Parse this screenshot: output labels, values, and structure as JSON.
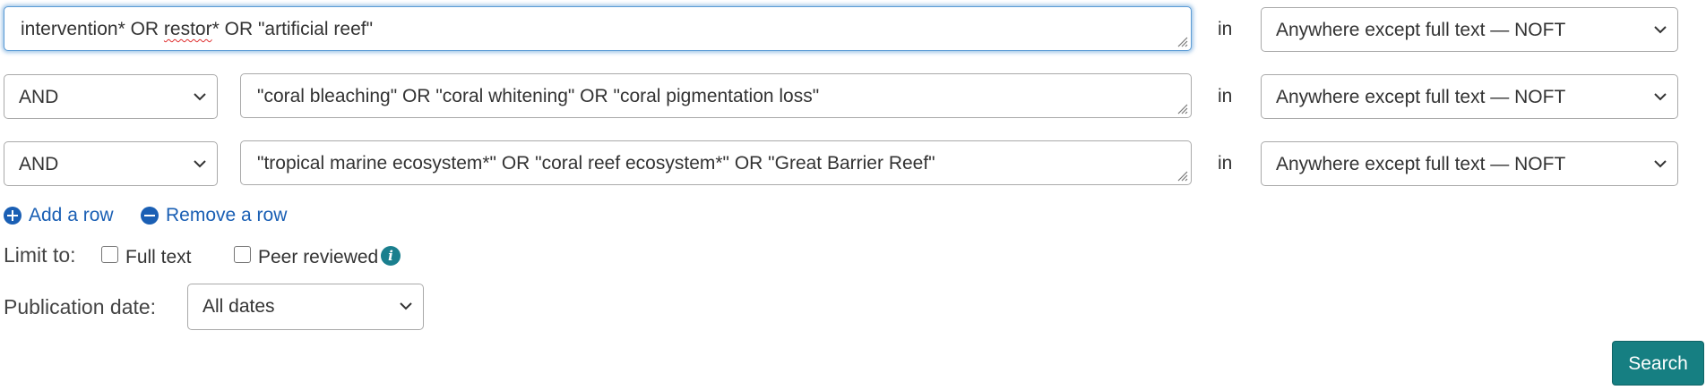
{
  "rows": [
    {
      "query_parts": [
        "intervention* OR ",
        "restor",
        "* OR \"artificial reef\""
      ],
      "in_label": "in",
      "field": "Anywhere except full text — NOFT"
    },
    {
      "operator": "AND",
      "query": "\"coral bleaching\" OR \"coral whitening\" OR \"coral pigmentation loss\"",
      "in_label": "in",
      "field": "Anywhere except full text — NOFT"
    },
    {
      "operator": "AND",
      "query": "\"tropical marine ecosystem*\" OR \"coral reef ecosystem*\" OR \"Great Barrier Reef\"",
      "in_label": "in",
      "field": "Anywhere except full text — NOFT"
    }
  ],
  "row_actions": {
    "add": "Add a row",
    "remove": "Remove a row"
  },
  "limit": {
    "label": "Limit to:",
    "full_text": {
      "label": "Full text",
      "checked": false
    },
    "peer_reviewed": {
      "label": "Peer reviewed",
      "checked": false
    },
    "info_icon": "info-icon"
  },
  "publication_date": {
    "label": "Publication date:",
    "value": "All dates"
  },
  "search_button": "Search",
  "colors": {
    "link": "#1a5fb4",
    "button": "#167f82",
    "focus": "#5b9bd5",
    "info": "#1a7f8e"
  }
}
